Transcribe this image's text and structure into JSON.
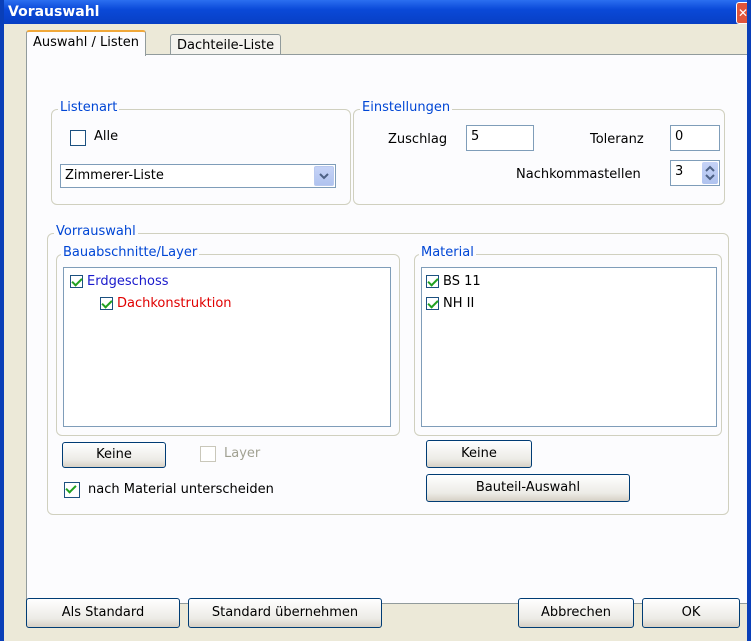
{
  "window": {
    "title": "Vorauswahl",
    "close_glyph": "✕"
  },
  "tabs": [
    {
      "label": "Auswahl / Listen",
      "active": true
    },
    {
      "label": "Dachteile-Liste",
      "active": false
    }
  ],
  "listenart": {
    "legend": "Listenart",
    "alle_label": "Alle",
    "alle_checked": false,
    "dropdown_value": "Zimmerer-Liste"
  },
  "einstellungen": {
    "legend": "Einstellungen",
    "zuschlag_label": "Zuschlag",
    "zuschlag_value": "5",
    "toleranz_label": "Toleranz",
    "toleranz_value": "0",
    "nachkommastellen_label": "Nachkommastellen",
    "nachkommastellen_value": "3"
  },
  "vorrauswahl": {
    "legend": "Vorrauswahl",
    "bauabschnitte": {
      "legend": "Bauabschnitte/Layer",
      "items": [
        {
          "label": "Erdgeschoss",
          "checked": true,
          "color": "#1a1acc",
          "indent": 0
        },
        {
          "label": "Dachkonstruktion",
          "checked": true,
          "color": "#e00000",
          "indent": 1
        }
      ],
      "keine_label": "Keine",
      "layer_label": "Layer",
      "layer_checked": false,
      "nach_material_label": "nach Material unterscheiden",
      "nach_material_checked": true
    },
    "material": {
      "legend": "Material",
      "items": [
        {
          "label": "BS 11",
          "checked": true
        },
        {
          "label": "NH II",
          "checked": true
        }
      ],
      "keine_label": "Keine",
      "bauteil_label": "Bauteil-Auswahl"
    }
  },
  "footer": {
    "als_standard": "Als Standard",
    "standard_uebernehmen": "Standard übernehmen",
    "abbrechen": "Abbrechen",
    "ok": "OK"
  },
  "colors": {
    "accent": "#0046d5",
    "titlebar": "#0a49d8"
  }
}
